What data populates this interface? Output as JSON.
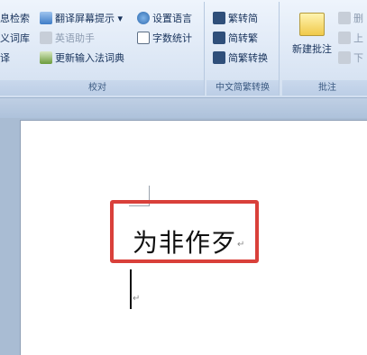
{
  "ribbon": {
    "proofing": {
      "footer": "校对",
      "items": [
        {
          "label": "息检索",
          "icon": "research-icon"
        },
        {
          "label": "义词库",
          "icon": "thesaurus-icon"
        },
        {
          "label": "译",
          "icon": "translate-icon"
        },
        {
          "label": "翻译屏幕提示 ▾",
          "icon": "translation-screentip-icon"
        },
        {
          "label": "英语助手",
          "icon": "english-assistant-icon"
        },
        {
          "label": "更新输入法词典",
          "icon": "ime-dictionary-icon"
        },
        {
          "label": "设置语言",
          "icon": "set-language-icon"
        },
        {
          "label": "字数统计",
          "icon": "word-count-icon"
        }
      ]
    },
    "chinese_conversion": {
      "footer": "中文简繁转换",
      "items": [
        {
          "label": "繁转简",
          "icon": "trad-to-simp-icon"
        },
        {
          "label": "简转繁",
          "icon": "simp-to-trad-icon"
        },
        {
          "label": "简繁转换",
          "icon": "chinese-conversion-icon"
        }
      ]
    },
    "comments": {
      "footer": "批注",
      "new_comment": "新建批注",
      "items": [
        {
          "label": "删",
          "icon": "delete-comment-icon"
        },
        {
          "label": "上",
          "icon": "previous-comment-icon"
        },
        {
          "label": "下",
          "icon": "next-comment-icon"
        }
      ]
    }
  },
  "document": {
    "text": "为非作歹",
    "paragraph_mark": "↵"
  },
  "colors": {
    "highlight_border": "#d9403a",
    "ribbon_text": "#16315a"
  }
}
